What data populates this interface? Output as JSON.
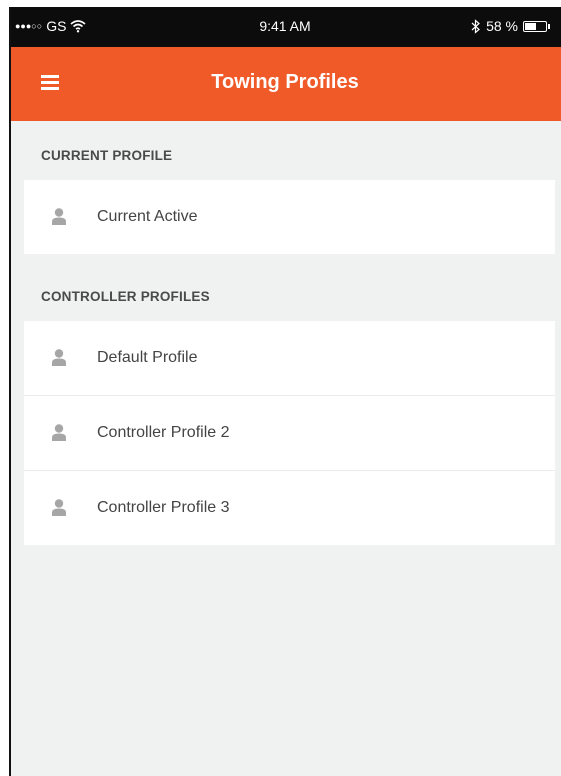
{
  "status_bar": {
    "signal": "●●●○○",
    "carrier": "GS",
    "time": "9:41 AM",
    "battery": "58 %",
    "battery_level": 0.58
  },
  "nav": {
    "title": "Towing Profiles"
  },
  "sections": {
    "current": {
      "header": "CURRENT PROFILE",
      "items": [
        {
          "label": "Current Active"
        }
      ]
    },
    "controller": {
      "header": "CONTROLLER PROFILES",
      "items": [
        {
          "label": "Default Profile"
        },
        {
          "label": "Controller Profile 2"
        },
        {
          "label": "Controller Profile 3"
        }
      ]
    }
  },
  "colors": {
    "accent": "#f05a28",
    "background": "#f0f1f1",
    "icon": "#a6a6a6"
  },
  "icons": [
    "menu-icon",
    "user-icon",
    "wifi-icon",
    "bluetooth-icon",
    "battery-icon"
  ]
}
